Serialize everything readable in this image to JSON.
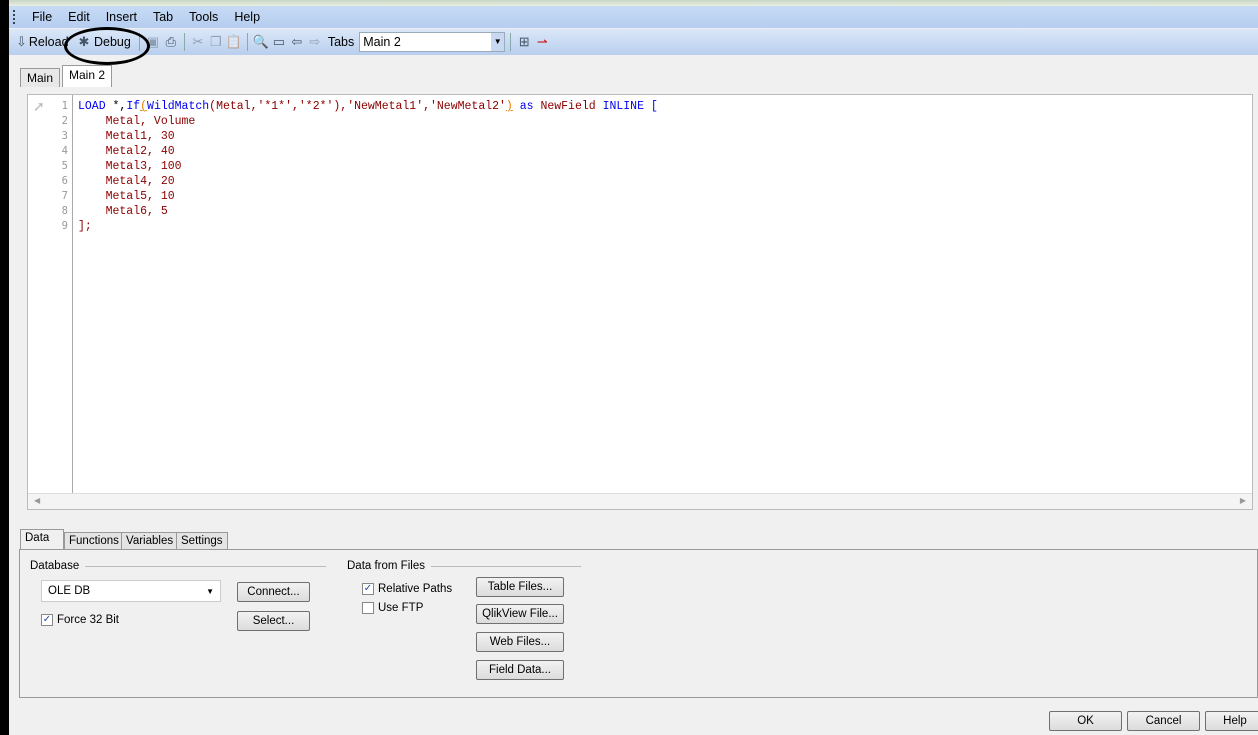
{
  "menu": [
    "File",
    "Edit",
    "Insert",
    "Tab",
    "Tools",
    "Help"
  ],
  "toolbar": {
    "reload": "Reload",
    "debug": "Debug",
    "tabs_label": "Tabs",
    "tabs_value": "Main 2"
  },
  "editor_tabs": [
    "Main",
    "Main 2"
  ],
  "code": {
    "line_numbers": [
      "1",
      "2",
      "3",
      "4",
      "5",
      "6",
      "7",
      "8",
      "9"
    ],
    "lines": [
      [
        {
          "t": "LOAD",
          "k": "kw"
        },
        {
          "t": " *,",
          "k": "tx"
        },
        {
          "t": "If",
          "k": "kw"
        },
        {
          "t": "(",
          "k": "pa"
        },
        {
          "t": "WildMatch",
          "k": "kw"
        },
        {
          "t": "(Metal,'*1*','*2*'),'NewMetal1','NewMetal2'",
          "k": "id"
        },
        {
          "t": ")",
          "k": "pa"
        },
        {
          "t": " ",
          "k": "tx"
        },
        {
          "t": "as",
          "k": "kw"
        },
        {
          "t": " NewField ",
          "k": "id"
        },
        {
          "t": "INLINE [",
          "k": "kw"
        }
      ],
      [
        {
          "t": "    Metal, Volume",
          "k": "id"
        }
      ],
      [
        {
          "t": "    Metal1, 30",
          "k": "id"
        }
      ],
      [
        {
          "t": "    Metal2, 40",
          "k": "id"
        }
      ],
      [
        {
          "t": "    Metal3, 100",
          "k": "id"
        }
      ],
      [
        {
          "t": "    Metal4, 20",
          "k": "id"
        }
      ],
      [
        {
          "t": "    Metal5, 10",
          "k": "id"
        }
      ],
      [
        {
          "t": "    Metal6, 5",
          "k": "id"
        }
      ],
      [
        {
          "t": "];",
          "k": "id"
        }
      ]
    ]
  },
  "bottom_tabs": [
    "Data",
    "Functions",
    "Variables",
    "Settings"
  ],
  "data_tab": {
    "database_label": "Database",
    "database_value": "OLE DB",
    "force32": "Force 32 Bit",
    "force32_checked": true,
    "connect": "Connect...",
    "select": "Select...",
    "files_label": "Data from Files",
    "relative_paths": "Relative Paths",
    "relative_checked": true,
    "use_ftp": "Use FTP",
    "ftp_checked": false,
    "table_files": "Table Files...",
    "qlikview_file": "QlikView File...",
    "web_files": "Web Files...",
    "field_data": "Field Data..."
  },
  "footer": {
    "ok": "OK",
    "cancel": "Cancel",
    "help": "Help"
  }
}
